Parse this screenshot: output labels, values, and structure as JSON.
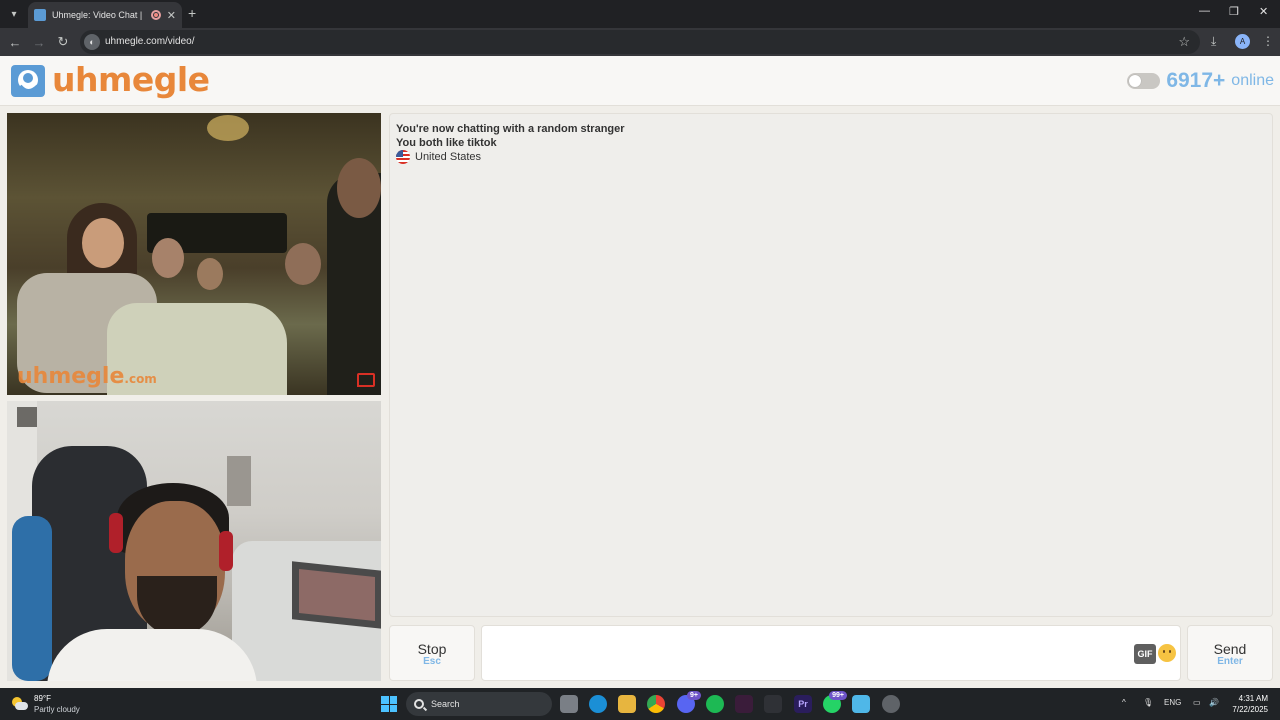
{
  "browser": {
    "tab_title": "Uhmegle: Video Chat | Ome",
    "url": "uhmegle.com/video/",
    "profile_initial": "A"
  },
  "header": {
    "logo_text": "uhmegle",
    "online_count": "6917+",
    "online_label": "online"
  },
  "video": {
    "watermark": "uhmegle",
    "watermark_suffix": ".com"
  },
  "chat": {
    "lines": [
      "You're now chatting with a random stranger",
      "You both like tiktok"
    ],
    "country": "United States"
  },
  "controls": {
    "stop_label": "Stop",
    "stop_key": "Esc",
    "send_label": "Send",
    "send_key": "Enter",
    "gif_label": "GIF",
    "message_value": ""
  },
  "taskbar": {
    "weather_temp": "89°F",
    "weather_desc": "Partly cloudy",
    "search_label": "Search",
    "discord_badge": "9+",
    "whatsapp_badge": "99+",
    "language": "ENG",
    "time": "4:31 AM",
    "date": "7/22/2025"
  },
  "colors": {
    "brand_orange": "#e8873a",
    "brand_blue": "#7fb7e6",
    "page_bg": "#f0eee9"
  }
}
